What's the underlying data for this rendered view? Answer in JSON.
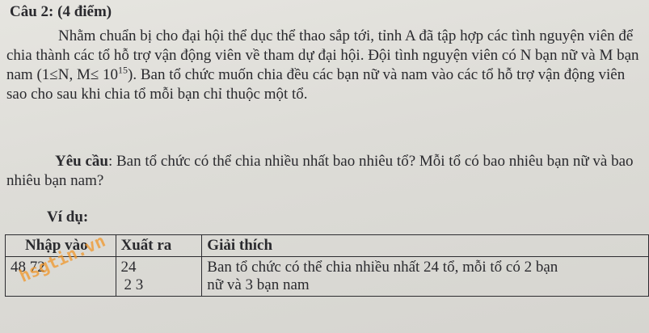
{
  "question": {
    "title": "Câu 2: (4 điểm)",
    "paragraph1": {
      "text_before_sup": "Nhằm chuẩn bị cho đại hội thể dục thể thao sắp tới, tỉnh A đã tập hợp các tình nguyện viên để chia thành các tổ hỗ trợ vận động viên về tham dự đại hội. Đội tình nguyện viên có N bạn nữ và M bạn nam (1≤N, M≤ 10",
      "sup": "15",
      "text_after_sup": "). Ban tổ chức muốn chia đều các bạn nữ và nam vào các tổ hỗ trợ vận động viên sao cho sau khi chia tổ mỗi bạn chỉ thuộc một tổ."
    },
    "paragraph2": {
      "label": "Yêu cầu",
      "text": ": Ban tổ chức có thể chia nhiều nhất bao nhiêu tổ? Mỗi tổ có bao nhiêu bạn nữ và bao nhiêu bạn nam?"
    },
    "example_label": "Ví dụ:"
  },
  "example_table": {
    "headers": [
      "Nhập vào",
      "Xuất ra",
      "Giải thích"
    ],
    "rows": [
      {
        "input": "48  72",
        "output_line1": "24",
        "output_line2": "2  3",
        "explanation_line1": "Ban tổ chức có thể chia nhiều nhất 24 tổ, mỗi tổ có 2 bạn",
        "explanation_line2": "nữ và 3 bạn nam"
      }
    ]
  },
  "watermark": "hsgtin.vn"
}
